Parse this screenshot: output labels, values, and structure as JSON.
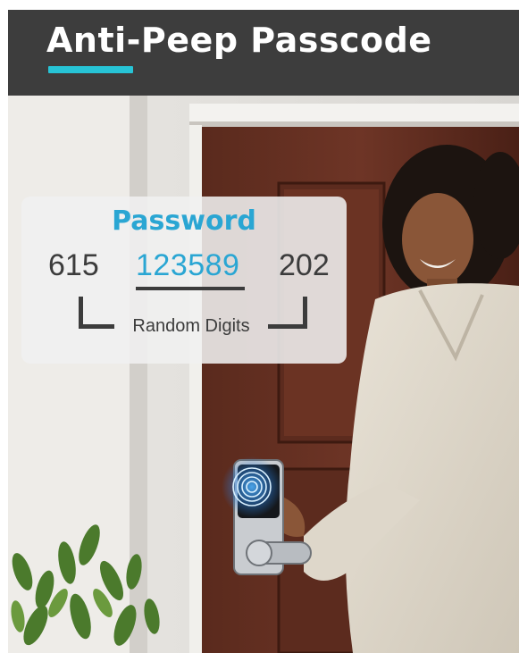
{
  "banner": {
    "title": "Anti-Peep Passcode",
    "accent_color": "#27c4d6",
    "background_color": "#3d3d3d"
  },
  "passcode_card": {
    "heading": "Password",
    "random_prefix": "615",
    "real_password": "123589",
    "random_suffix": "202",
    "caption": "Random Digits",
    "highlight_color": "#2aa6d3"
  },
  "scene": {
    "icon": "fingerprint-icon"
  }
}
